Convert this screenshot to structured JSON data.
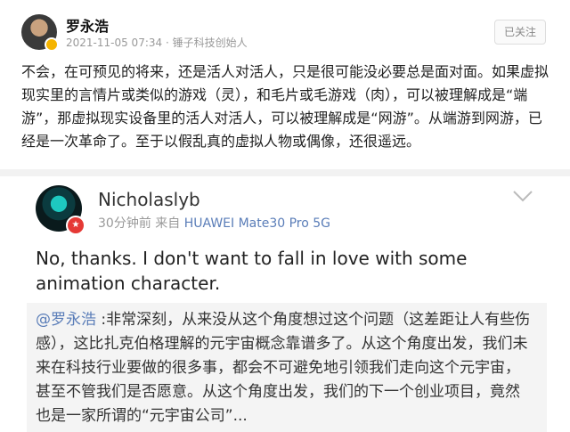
{
  "post": {
    "author": "罗永浩",
    "meta": "2021-11-05 07:34 · 锤子科技创始人",
    "follow_label": "已关注",
    "text": "不会，在可预见的将来，还是活人对活人，只是很可能没必要总是面对面。如果虚拟现实里的言情片或类似的游戏（灵），和毛片或毛游戏（肉），可以被理解成是“端游”，那虚拟现实设备里的活人对活人，可以被理解成是“网游”。从端游到网游，已经是一次革命了。至于以假乱真的虚拟人物或偶像，还很遥远。"
  },
  "reply": {
    "author": "Nicholaslyb",
    "time": "30分钟前",
    "from": "来自",
    "device": "HUAWEI Mate30 Pro 5G",
    "text": "No, thanks. I don't want to fall in love with some animation character.",
    "quote_mention": "@罗永浩",
    "quote_text": " :非常深刻，从来没从这个角度想过这个问题（这差距让人有些伤感），这比扎克伯格理解的元宇宙概念靠谱多了。从这个角度出发，我们未来在科技行业要做的很多事，都会不可避免地引领我们走向这个元宇宙，甚至不管我们是否愿意。从这个角度出发，我们的下一个创业项目，竟然也是一家所谓的“元宇宙公司”..."
  }
}
